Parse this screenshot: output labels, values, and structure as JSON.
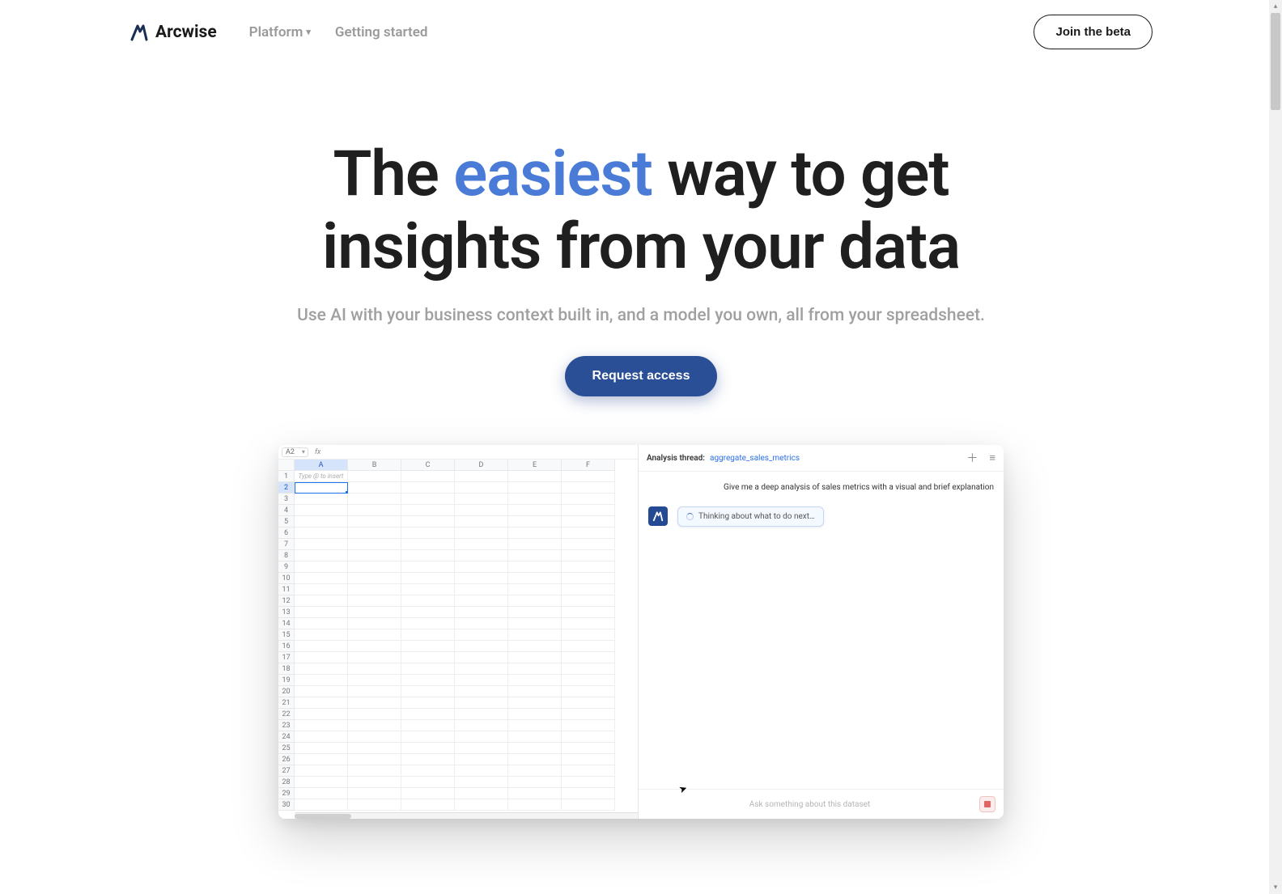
{
  "nav": {
    "brand": "Arcwise",
    "platform": "Platform",
    "getting_started": "Getting started",
    "join_beta": "Join the beta"
  },
  "hero": {
    "title_pre": "The ",
    "title_highlight": "easiest",
    "title_mid": " way to get",
    "title_line2": "insights from your data",
    "subheading": "Use AI with your business context built in, and a model you own, all from your spreadsheet.",
    "cta": "Request access"
  },
  "sheet": {
    "cell_ref": "A2",
    "fx_label": "fx",
    "columns": [
      "A",
      "B",
      "C",
      "D",
      "E",
      "F"
    ],
    "row_count": 30,
    "insert_hint": "Type @ to insert",
    "selected_col": "A",
    "selected_row": 2
  },
  "thread": {
    "header_label": "Analysis thread:",
    "name": "aggregate_sales_metrics",
    "user_message": "Give me a deep analysis of sales metrics with a visual and brief explanation",
    "thinking": "Thinking about what to do next…",
    "input_placeholder": "Ask something about this dataset"
  }
}
